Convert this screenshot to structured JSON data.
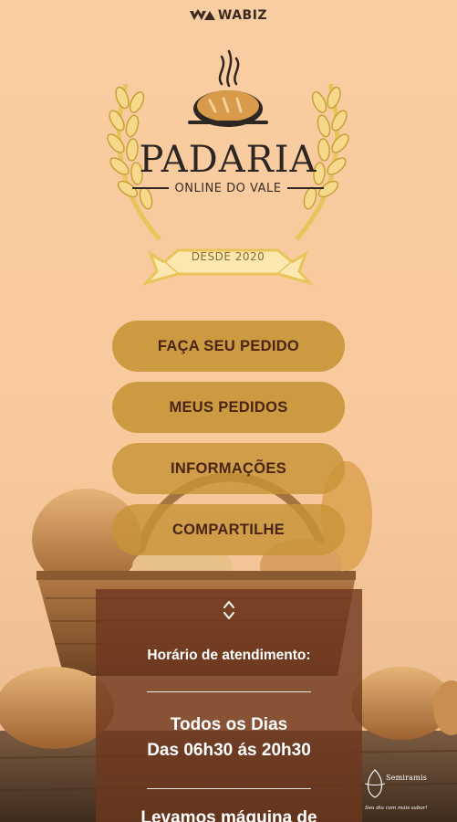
{
  "brand": {
    "name": "WABIZ",
    "icon": "wabiz-logo-icon"
  },
  "logo": {
    "title": "PADARIA",
    "subtitle": "ONLINE DO VALE",
    "since": "DESDE 2020",
    "icons": [
      "bread-icon",
      "steam-icon",
      "wheat-icon"
    ],
    "colors": {
      "gold": "#e9c45a",
      "dark": "#2e2622",
      "bread": "#d99a4a"
    }
  },
  "menu": {
    "items": [
      {
        "label": "FAÇA SEU PEDIDO"
      },
      {
        "label": "MEUS PEDIDOS"
      },
      {
        "label": "INFORMAÇÕES"
      },
      {
        "label": "COMPARTILHE"
      }
    ],
    "button_color": "#c8963a",
    "text_color": "#4a2414"
  },
  "info": {
    "icon": "expand-chevrons-icon",
    "heading": "Horário de atendimento:",
    "days": "Todos os Dias",
    "hours": "Das 06h30 ás 20h30",
    "more": "Levamos máquina de"
  },
  "watermark": {
    "name": "Semiramis",
    "tagline": "Seu dia com mais sabor!"
  }
}
